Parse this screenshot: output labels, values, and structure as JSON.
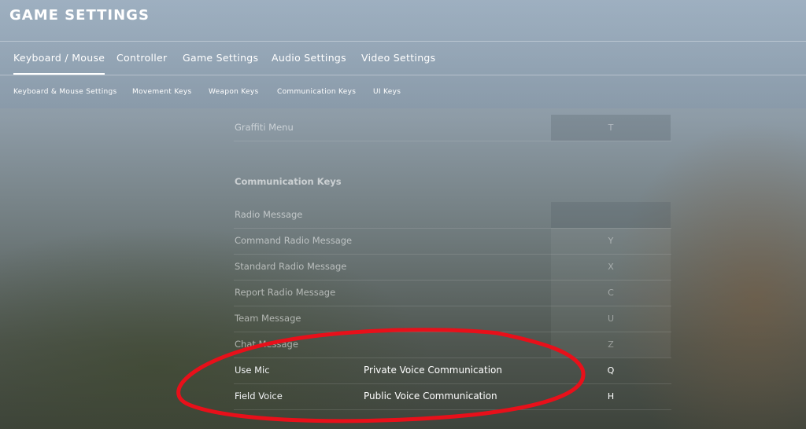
{
  "header": {
    "title": "GAME SETTINGS"
  },
  "tabs": [
    {
      "label": "Keyboard / Mouse"
    },
    {
      "label": "Controller"
    },
    {
      "label": "Game Settings"
    },
    {
      "label": "Audio Settings"
    },
    {
      "label": "Video Settings"
    }
  ],
  "subtabs": [
    {
      "label": "Keyboard & Mouse Settings"
    },
    {
      "label": "Movement Keys"
    },
    {
      "label": "Weapon Keys"
    },
    {
      "label": "Communication Keys"
    },
    {
      "label": "UI Keys"
    }
  ],
  "settings": {
    "graffiti": {
      "label": "Graffiti Menu",
      "key": "T"
    },
    "section_title": "Communication Keys",
    "rows": [
      {
        "label": "Radio Message",
        "key": ""
      },
      {
        "label": "Command Radio Message",
        "key": "Y"
      },
      {
        "label": "Standard Radio Message",
        "key": "X"
      },
      {
        "label": "Report Radio Message",
        "key": "C"
      },
      {
        "label": "Team Message",
        "key": "U"
      },
      {
        "label": "Chat Message",
        "key": "Z"
      },
      {
        "label": "Use Mic",
        "key": "Q",
        "desc": "Private Voice Communication"
      },
      {
        "label": "Field Voice",
        "key": "H",
        "desc": "Public Voice Communication"
      }
    ]
  },
  "annotation_color": "#e8101a"
}
